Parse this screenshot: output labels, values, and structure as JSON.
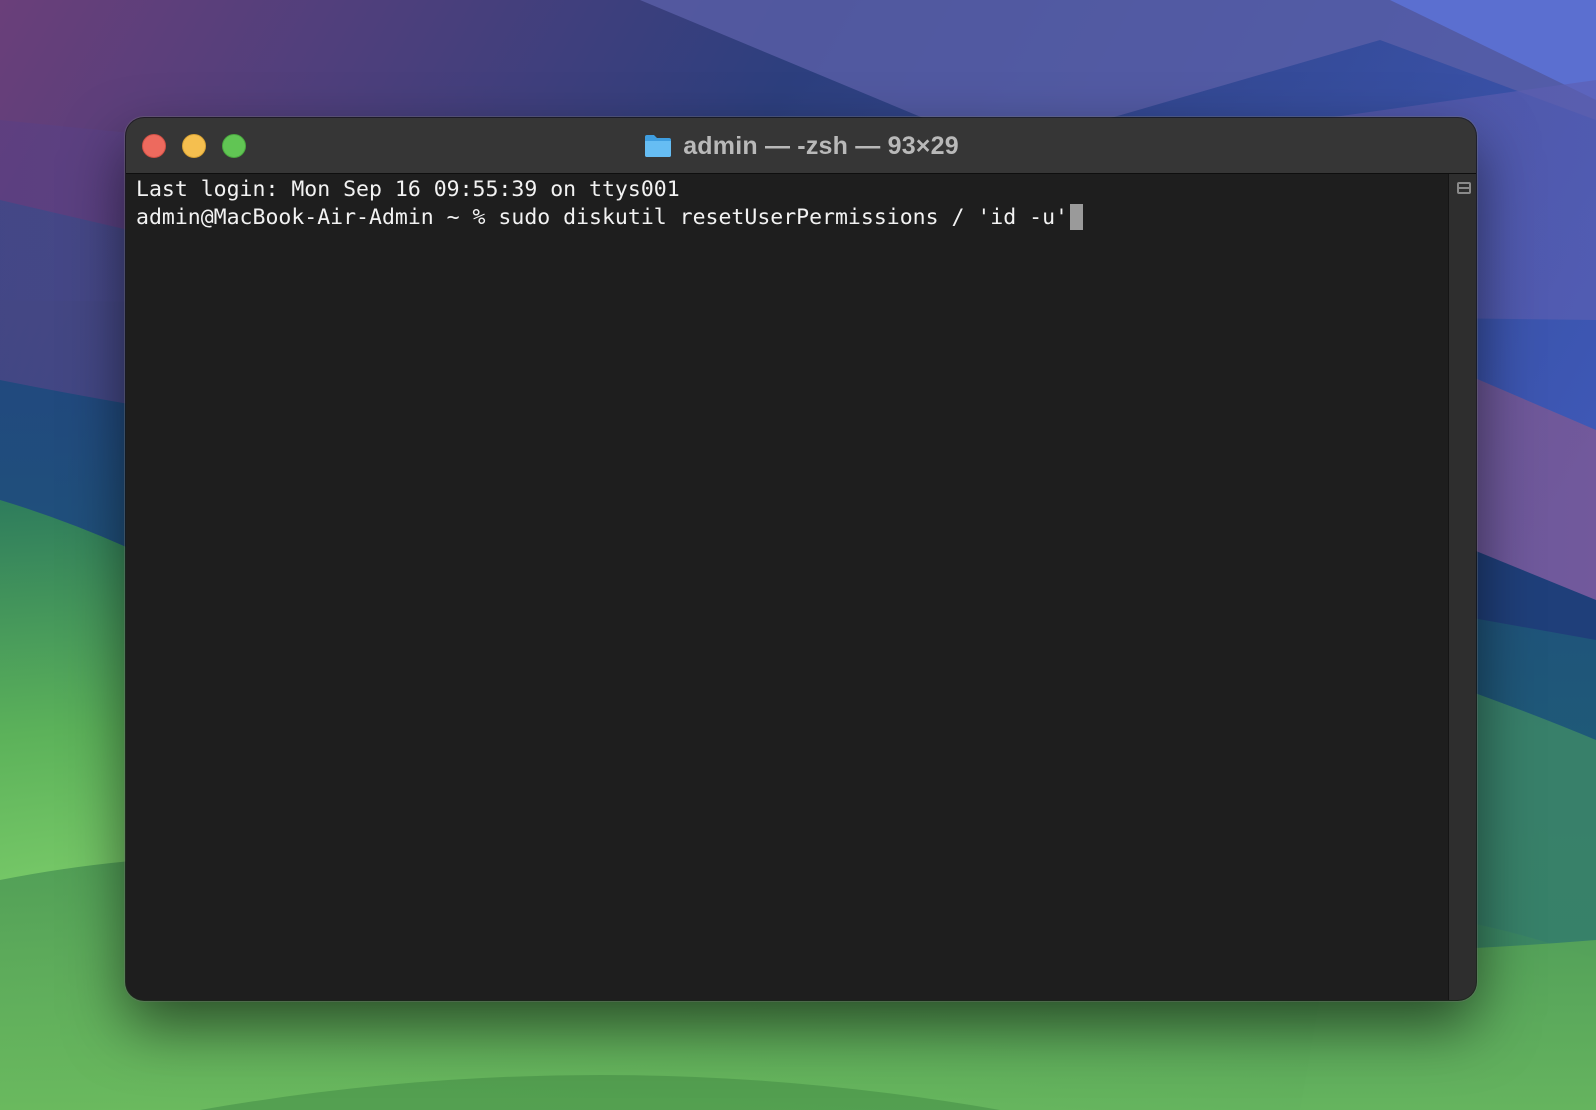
{
  "window": {
    "title": "admin — -zsh — 93×29"
  },
  "terminal": {
    "lines": [
      "Last login: Mon Sep 16 09:55:39 on ttys001",
      "admin@MacBook-Air-Admin ~ % sudo diskutil resetUserPermissions / 'id -u'"
    ]
  },
  "icons": {
    "title_icon": "folder-icon",
    "split_icon": "split-pane-icon"
  },
  "colors": {
    "close": "#ed6a5e",
    "minimize": "#f5bf4f",
    "zoom": "#61c554",
    "terminal_bg": "#1e1e1e",
    "terminal_text": "#f2f2f2"
  }
}
